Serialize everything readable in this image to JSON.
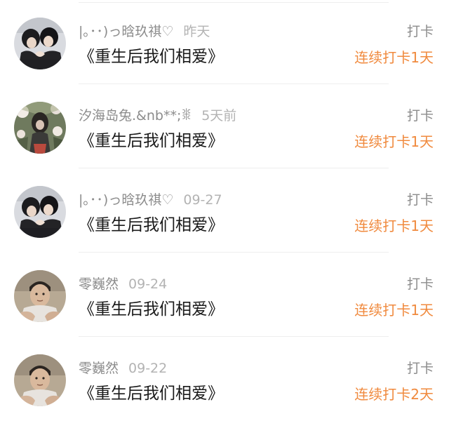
{
  "feed": {
    "items": [
      {
        "username": "|｡･･)っ晗玖祺♡",
        "time": "昨天",
        "book_title": "《重生后我们相爱》",
        "checkin_label": "打卡",
        "streak_text": "连续打卡1天",
        "avatar_icon": "couple-heart-hands-avatar"
      },
      {
        "username": "汐海岛兔.&nb**;ꒌ",
        "time": "5天前",
        "book_title": "《重生后我们相爱》",
        "checkin_label": "打卡",
        "streak_text": "连续打卡1天",
        "avatar_icon": "girl-with-flowers-avatar"
      },
      {
        "username": "|｡･･)っ晗玖祺♡",
        "time": "09-27",
        "book_title": "《重生后我们相爱》",
        "checkin_label": "打卡",
        "streak_text": "连续打卡1天",
        "avatar_icon": "couple-heart-hands-avatar"
      },
      {
        "username": "零巍然",
        "time": "09-24",
        "book_title": "《重生后我们相爱》",
        "checkin_label": "打卡",
        "streak_text": "连续打卡1天",
        "avatar_icon": "boy-portrait-avatar"
      },
      {
        "username": "零巍然",
        "time": "09-22",
        "book_title": "《重生后我们相爱》",
        "checkin_label": "打卡",
        "streak_text": "连续打卡2天",
        "avatar_icon": "boy-portrait-avatar"
      }
    ]
  },
  "colors": {
    "accent": "#f08a3e",
    "text_primary": "#1a1a1a",
    "text_secondary": "#8c8c8c",
    "text_tertiary": "#b3b3b3",
    "divider": "#eeeeee"
  }
}
